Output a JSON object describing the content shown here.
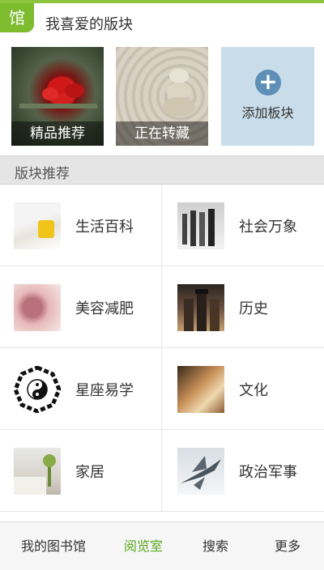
{
  "header": {
    "badge": "馆",
    "title": "我喜爱的版块"
  },
  "favorites": [
    {
      "caption": "精品推荐",
      "icon": "red-flowers-image"
    },
    {
      "caption": "正在转藏",
      "icon": "zen-stones-image"
    },
    {
      "caption": "添加板块",
      "icon": "plus-icon"
    }
  ],
  "section": {
    "title": "版块推荐"
  },
  "categories": [
    {
      "label": "生活百科",
      "icon": "lifestyle-image"
    },
    {
      "label": "社会万象",
      "icon": "society-image"
    },
    {
      "label": "美容减肥",
      "icon": "beauty-image"
    },
    {
      "label": "历史",
      "icon": "history-image"
    },
    {
      "label": "星座易学",
      "icon": "yin-yang-bagua-image"
    },
    {
      "label": "文化",
      "icon": "culture-image"
    },
    {
      "label": "家居",
      "icon": "home-image"
    },
    {
      "label": "政治军事",
      "icon": "fighter-jet-image"
    }
  ],
  "bottom_nav": {
    "items": [
      "我的图书馆",
      "阅览室",
      "搜索",
      "更多"
    ],
    "active": "阅览室"
  },
  "colors": {
    "accent": "#7dbb2f",
    "active_nav": "#5aa81e",
    "section_bg": "#e5e5e5",
    "add_tile_bg": "#c9dcea"
  }
}
